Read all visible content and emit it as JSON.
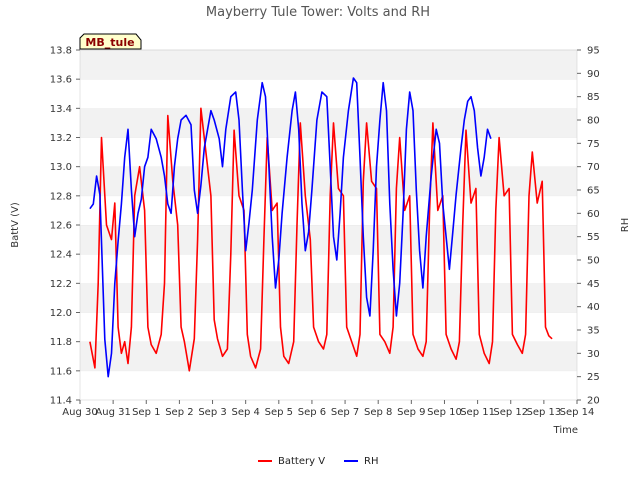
{
  "chart_data": {
    "type": "line",
    "title": "Mayberry Tule Tower: Volts and RH",
    "xlabel": "Time",
    "ylabel_left": "BattV (V)",
    "ylabel_right": "RH",
    "station_label": "MB_tule",
    "x_ticks": [
      "Aug 30",
      "Aug 31",
      "Sep 1",
      "Sep 2",
      "Sep 3",
      "Sep 4",
      "Sep 5",
      "Sep 6",
      "Sep 7",
      "Sep 8",
      "Sep 9",
      "Sep 10",
      "Sep 11",
      "Sep 12",
      "Sep 13",
      "Sep 14"
    ],
    "x_range_days": [
      0,
      15
    ],
    "y_left_ticks": [
      "11.4",
      "11.6",
      "11.8",
      "12.0",
      "12.2",
      "12.4",
      "12.6",
      "12.8",
      "13.0",
      "13.2",
      "13.4",
      "13.6",
      "13.8"
    ],
    "y_left_range": [
      11.4,
      13.8
    ],
    "y_right_ticks": [
      "20",
      "25",
      "30",
      "35",
      "40",
      "45",
      "50",
      "55",
      "60",
      "65",
      "70",
      "75",
      "80",
      "85",
      "90",
      "95"
    ],
    "y_right_range": [
      20,
      95
    ],
    "grid": "horizontal bands",
    "legend_position": "bottom",
    "series": [
      {
        "name": "Battery V",
        "color": "#ff0000",
        "axis": "left",
        "points": [
          [
            0.3,
            11.8
          ],
          [
            0.45,
            11.62
          ],
          [
            0.55,
            12.2
          ],
          [
            0.65,
            13.2
          ],
          [
            0.8,
            12.6
          ],
          [
            0.95,
            12.5
          ],
          [
            1.05,
            12.75
          ],
          [
            1.15,
            11.9
          ],
          [
            1.25,
            11.72
          ],
          [
            1.35,
            11.8
          ],
          [
            1.45,
            11.65
          ],
          [
            1.55,
            11.9
          ],
          [
            1.65,
            12.8
          ],
          [
            1.8,
            13.0
          ],
          [
            1.95,
            12.7
          ],
          [
            2.05,
            11.9
          ],
          [
            2.15,
            11.78
          ],
          [
            2.3,
            11.72
          ],
          [
            2.45,
            11.85
          ],
          [
            2.55,
            12.2
          ],
          [
            2.65,
            13.35
          ],
          [
            2.8,
            12.9
          ],
          [
            2.95,
            12.6
          ],
          [
            3.05,
            11.9
          ],
          [
            3.15,
            11.8
          ],
          [
            3.3,
            11.6
          ],
          [
            3.45,
            11.82
          ],
          [
            3.55,
            12.5
          ],
          [
            3.65,
            13.4
          ],
          [
            3.8,
            13.1
          ],
          [
            3.95,
            12.8
          ],
          [
            4.05,
            11.95
          ],
          [
            4.15,
            11.82
          ],
          [
            4.3,
            11.7
          ],
          [
            4.45,
            11.75
          ],
          [
            4.55,
            12.4
          ],
          [
            4.65,
            13.25
          ],
          [
            4.8,
            12.8
          ],
          [
            4.95,
            12.7
          ],
          [
            5.05,
            11.85
          ],
          [
            5.15,
            11.7
          ],
          [
            5.3,
            11.62
          ],
          [
            5.45,
            11.75
          ],
          [
            5.55,
            12.5
          ],
          [
            5.65,
            13.2
          ],
          [
            5.8,
            12.7
          ],
          [
            5.95,
            12.75
          ],
          [
            6.05,
            11.9
          ],
          [
            6.15,
            11.7
          ],
          [
            6.3,
            11.65
          ],
          [
            6.45,
            11.8
          ],
          [
            6.55,
            12.6
          ],
          [
            6.65,
            13.3
          ],
          [
            6.8,
            12.8
          ],
          [
            6.95,
            12.5
          ],
          [
            7.05,
            11.9
          ],
          [
            7.2,
            11.8
          ],
          [
            7.35,
            11.75
          ],
          [
            7.45,
            11.85
          ],
          [
            7.55,
            12.8
          ],
          [
            7.65,
            13.3
          ],
          [
            7.8,
            12.85
          ],
          [
            7.95,
            12.8
          ],
          [
            8.05,
            11.9
          ],
          [
            8.2,
            11.8
          ],
          [
            8.35,
            11.7
          ],
          [
            8.45,
            11.85
          ],
          [
            8.55,
            12.9
          ],
          [
            8.65,
            13.3
          ],
          [
            8.8,
            12.9
          ],
          [
            8.95,
            12.85
          ],
          [
            9.05,
            11.85
          ],
          [
            9.2,
            11.8
          ],
          [
            9.35,
            11.72
          ],
          [
            9.45,
            11.9
          ],
          [
            9.55,
            12.85
          ],
          [
            9.65,
            13.2
          ],
          [
            9.8,
            12.7
          ],
          [
            9.95,
            12.8
          ],
          [
            10.05,
            11.85
          ],
          [
            10.2,
            11.75
          ],
          [
            10.35,
            11.7
          ],
          [
            10.45,
            11.8
          ],
          [
            10.55,
            12.7
          ],
          [
            10.65,
            13.3
          ],
          [
            10.8,
            12.7
          ],
          [
            10.95,
            12.8
          ],
          [
            11.05,
            11.85
          ],
          [
            11.2,
            11.75
          ],
          [
            11.35,
            11.68
          ],
          [
            11.45,
            11.8
          ],
          [
            11.55,
            12.6
          ],
          [
            11.65,
            13.25
          ],
          [
            11.8,
            12.75
          ],
          [
            11.95,
            12.85
          ],
          [
            12.05,
            11.85
          ],
          [
            12.2,
            11.72
          ],
          [
            12.35,
            11.65
          ],
          [
            12.45,
            11.8
          ],
          [
            12.55,
            12.7
          ],
          [
            12.65,
            13.2
          ],
          [
            12.8,
            12.8
          ],
          [
            12.95,
            12.85
          ],
          [
            13.05,
            11.85
          ],
          [
            13.2,
            11.78
          ],
          [
            13.35,
            11.72
          ],
          [
            13.45,
            11.85
          ],
          [
            13.55,
            12.8
          ],
          [
            13.65,
            13.1
          ],
          [
            13.8,
            12.75
          ],
          [
            13.95,
            12.9
          ],
          [
            14.05,
            11.9
          ],
          [
            14.15,
            11.84
          ],
          [
            14.25,
            11.82
          ]
        ]
      },
      {
        "name": "RH",
        "color": "#0000ff",
        "axis": "right",
        "points": [
          [
            0.3,
            61
          ],
          [
            0.4,
            62
          ],
          [
            0.5,
            68
          ],
          [
            0.6,
            64
          ],
          [
            0.75,
            33
          ],
          [
            0.85,
            25
          ],
          [
            0.95,
            30
          ],
          [
            1.05,
            45
          ],
          [
            1.15,
            54
          ],
          [
            1.25,
            62
          ],
          [
            1.35,
            72
          ],
          [
            1.45,
            78
          ],
          [
            1.55,
            65
          ],
          [
            1.65,
            55
          ],
          [
            1.75,
            60
          ],
          [
            1.85,
            63
          ],
          [
            1.95,
            70
          ],
          [
            2.05,
            72
          ],
          [
            2.15,
            78
          ],
          [
            2.3,
            76
          ],
          [
            2.45,
            72
          ],
          [
            2.55,
            68
          ],
          [
            2.65,
            62
          ],
          [
            2.75,
            60
          ],
          [
            2.85,
            70
          ],
          [
            2.95,
            76
          ],
          [
            3.05,
            80
          ],
          [
            3.2,
            81
          ],
          [
            3.35,
            79
          ],
          [
            3.45,
            65
          ],
          [
            3.55,
            60
          ],
          [
            3.65,
            66
          ],
          [
            3.75,
            74
          ],
          [
            3.85,
            78
          ],
          [
            3.95,
            82
          ],
          [
            4.05,
            80
          ],
          [
            4.2,
            76
          ],
          [
            4.3,
            70
          ],
          [
            4.4,
            78
          ],
          [
            4.55,
            85
          ],
          [
            4.7,
            86
          ],
          [
            4.8,
            80
          ],
          [
            4.9,
            65
          ],
          [
            5.0,
            52
          ],
          [
            5.1,
            58
          ],
          [
            5.2,
            65
          ],
          [
            5.35,
            80
          ],
          [
            5.5,
            88
          ],
          [
            5.6,
            85
          ],
          [
            5.7,
            70
          ],
          [
            5.8,
            55
          ],
          [
            5.9,
            44
          ],
          [
            6.0,
            50
          ],
          [
            6.1,
            60
          ],
          [
            6.25,
            72
          ],
          [
            6.4,
            82
          ],
          [
            6.5,
            86
          ],
          [
            6.6,
            78
          ],
          [
            6.7,
            62
          ],
          [
            6.8,
            52
          ],
          [
            6.9,
            56
          ],
          [
            7.0,
            65
          ],
          [
            7.15,
            80
          ],
          [
            7.3,
            86
          ],
          [
            7.45,
            85
          ],
          [
            7.55,
            70
          ],
          [
            7.65,
            55
          ],
          [
            7.75,
            50
          ],
          [
            7.85,
            60
          ],
          [
            7.95,
            72
          ],
          [
            8.1,
            82
          ],
          [
            8.25,
            89
          ],
          [
            8.35,
            88
          ],
          [
            8.45,
            72
          ],
          [
            8.55,
            55
          ],
          [
            8.65,
            42
          ],
          [
            8.75,
            38
          ],
          [
            8.85,
            52
          ],
          [
            8.95,
            70
          ],
          [
            9.05,
            80
          ],
          [
            9.15,
            88
          ],
          [
            9.25,
            82
          ],
          [
            9.35,
            62
          ],
          [
            9.45,
            48
          ],
          [
            9.55,
            38
          ],
          [
            9.65,
            45
          ],
          [
            9.75,
            60
          ],
          [
            9.85,
            78
          ],
          [
            9.95,
            86
          ],
          [
            10.05,
            82
          ],
          [
            10.15,
            65
          ],
          [
            10.25,
            52
          ],
          [
            10.35,
            44
          ],
          [
            10.45,
            55
          ],
          [
            10.6,
            68
          ],
          [
            10.75,
            78
          ],
          [
            10.85,
            75
          ],
          [
            10.95,
            62
          ],
          [
            11.05,
            55
          ],
          [
            11.15,
            48
          ],
          [
            11.25,
            56
          ],
          [
            11.35,
            64
          ],
          [
            11.5,
            74
          ],
          [
            11.6,
            80
          ],
          [
            11.7,
            84
          ],
          [
            11.8,
            85
          ],
          [
            11.9,
            82
          ],
          [
            12.0,
            74
          ],
          [
            12.1,
            68
          ],
          [
            12.2,
            72
          ],
          [
            12.3,
            78
          ],
          [
            12.4,
            76
          ]
        ]
      }
    ]
  }
}
